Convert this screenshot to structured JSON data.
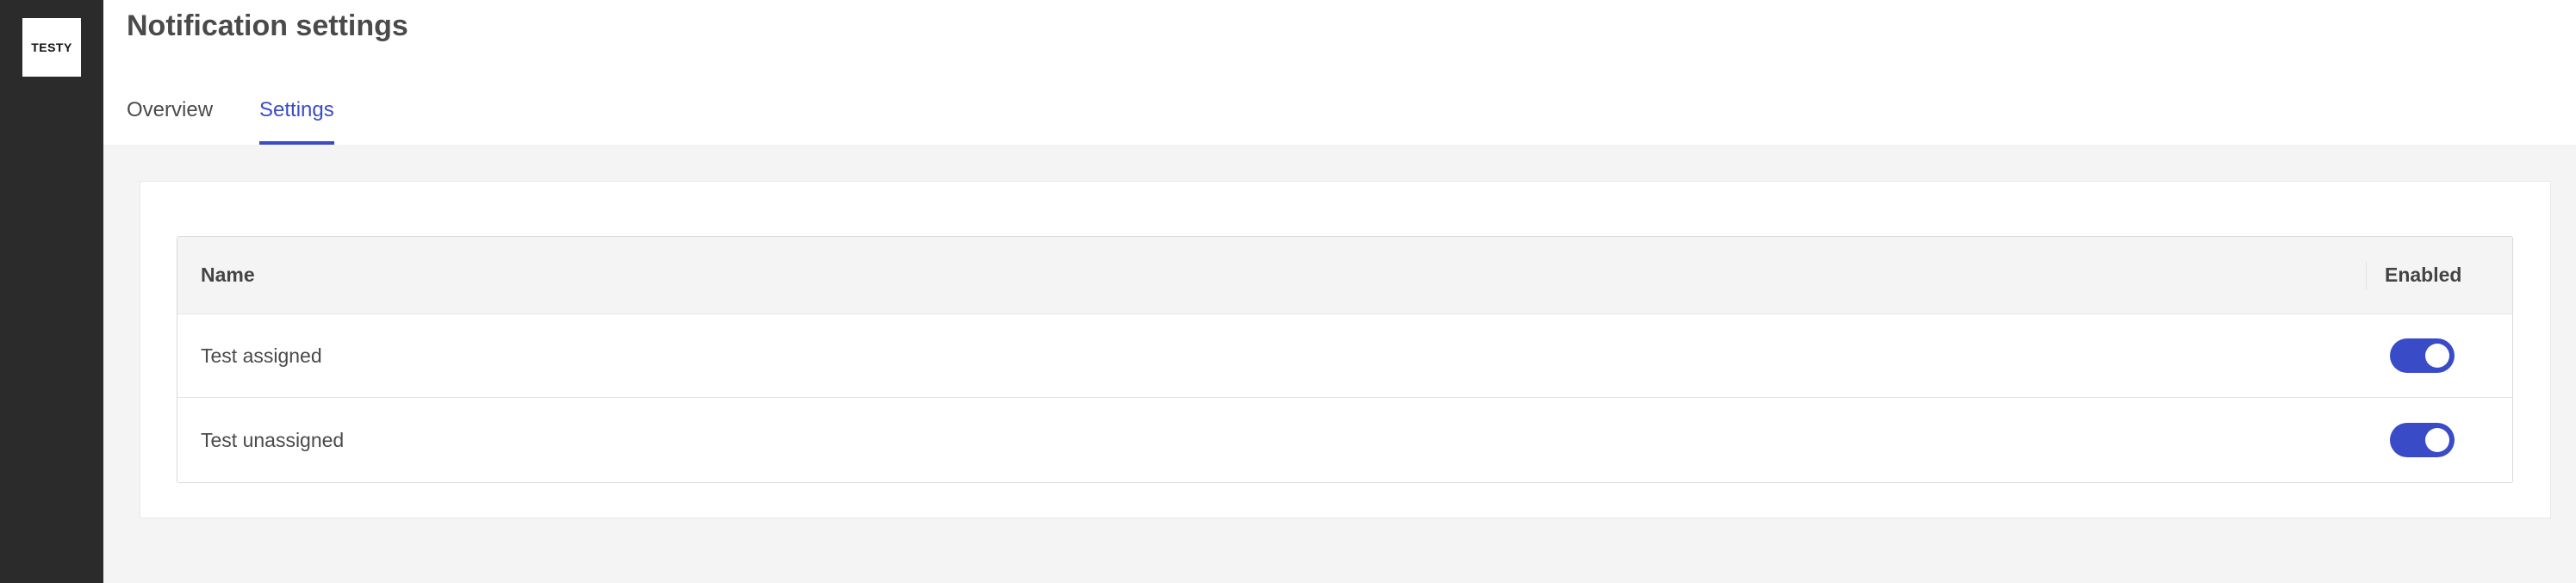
{
  "app": {
    "logo_text": "TESTY"
  },
  "header": {
    "title": "Notification settings",
    "tabs": [
      {
        "label": "Overview",
        "active": false
      },
      {
        "label": "Settings",
        "active": true
      }
    ]
  },
  "table": {
    "columns": [
      "Name",
      "Enabled"
    ],
    "rows": [
      {
        "name": "Test assigned",
        "enabled": true
      },
      {
        "name": "Test unassigned",
        "enabled": true
      }
    ]
  },
  "colors": {
    "accent": "#3a4bc8",
    "sidebar": "#2b2b2b"
  }
}
